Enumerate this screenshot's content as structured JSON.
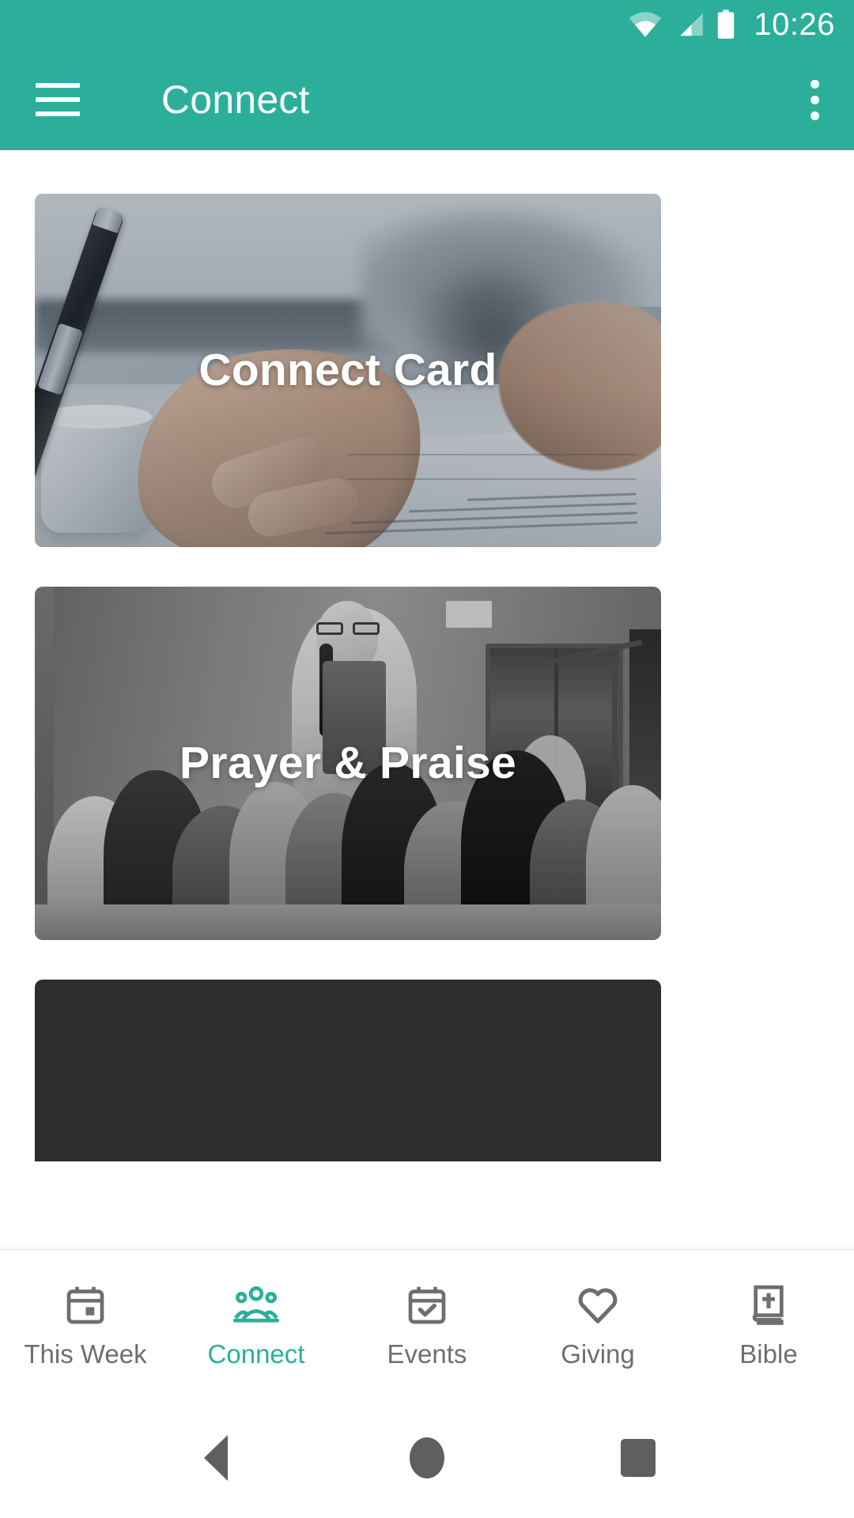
{
  "status_bar": {
    "time": "10:26",
    "icons": [
      "wifi-icon",
      "cellular-signal-icon",
      "battery-icon"
    ]
  },
  "app_bar": {
    "title": "Connect",
    "menu_icon": "hamburger-menu-icon",
    "overflow_icon": "overflow-menu-icon",
    "background_color": "#2BAF9B"
  },
  "cards": [
    {
      "label": "Connect Card",
      "image": "hand-writing-on-form-photo"
    },
    {
      "label": "Prayer & Praise",
      "image": "congregation-praying-photo"
    },
    {
      "label": "",
      "image": "dark-placeholder-card"
    }
  ],
  "tabs": [
    {
      "label": "This Week",
      "icon": "calendar-icon",
      "active": false
    },
    {
      "label": "Connect",
      "icon": "people-group-icon",
      "active": true
    },
    {
      "label": "Events",
      "icon": "calendar-check-icon",
      "active": false
    },
    {
      "label": "Giving",
      "icon": "heart-icon",
      "active": false
    },
    {
      "label": "Bible",
      "icon": "bible-book-icon",
      "active": false
    }
  ],
  "system_nav": {
    "back": "back-triangle-icon",
    "home": "home-circle-icon",
    "recents": "recents-square-icon"
  },
  "colors": {
    "accent": "#2BAF9B",
    "inactive_tab": "#6e6e6e",
    "dark_card": "#2d2d2d"
  }
}
